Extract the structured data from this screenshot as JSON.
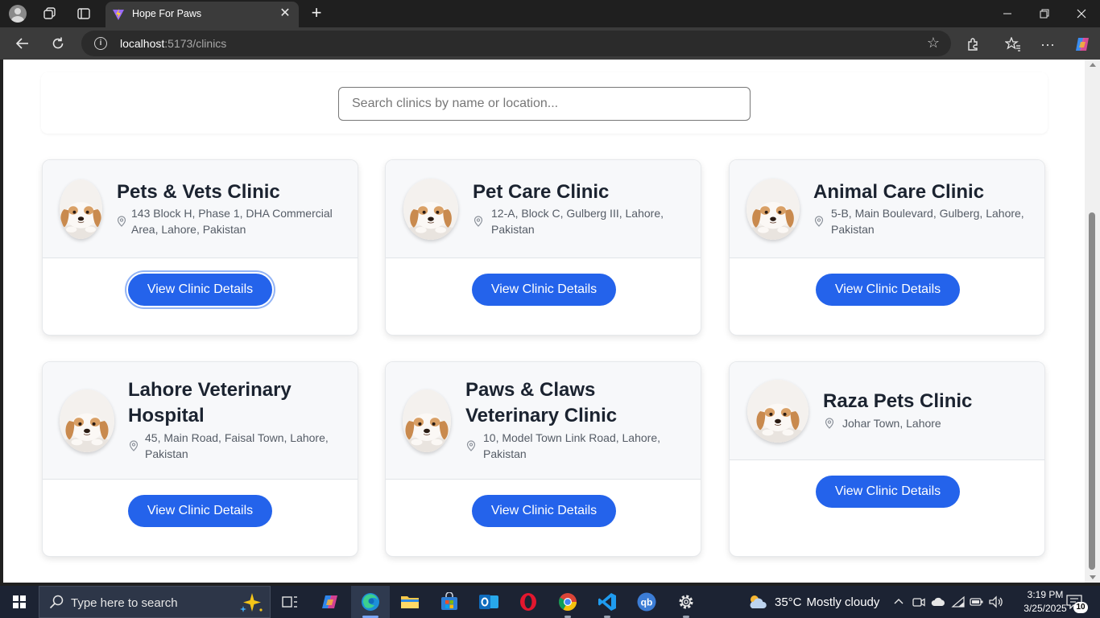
{
  "browser": {
    "tab_title": "Hope For Paws",
    "url_host": "localhost",
    "url_rest": ":5173/clinics"
  },
  "page": {
    "search_placeholder": "Search clinics by name or location...",
    "clinics": [
      {
        "name": "Pets & Vets Clinic",
        "address": "143 Block H, Phase 1, DHA Commercial Area, Lahore, Pakistan",
        "button": "View Clinic Details"
      },
      {
        "name": "Pet Care Clinic",
        "address": "12-A, Block C, Gulberg III, Lahore, Pakistan",
        "button": "View Clinic Details"
      },
      {
        "name": "Animal Care Clinic",
        "address": "5-B, Main Boulevard, Gulberg, Lahore, Pakistan",
        "button": "View Clinic Details"
      },
      {
        "name": "Lahore Veterinary Hospital",
        "address": "45, Main Road, Faisal Town, Lahore, Pakistan",
        "button": "View Clinic Details"
      },
      {
        "name": "Paws & Claws Veterinary Clinic",
        "address": "10, Model Town Link Road, Lahore, Pakistan",
        "button": "View Clinic Details"
      },
      {
        "name": "Raza Pets Clinic",
        "address": "Johar Town, Lahore",
        "button": "View Clinic Details"
      }
    ]
  },
  "taskbar": {
    "search_placeholder": "Type here to search",
    "weather_temp": "35°C",
    "weather_condition": "Mostly cloudy",
    "time": "3:19 PM",
    "date": "3/25/2025",
    "notification_count": "10"
  },
  "colors": {
    "primary_button": "#2463eb",
    "card_header": "#f7f8fa",
    "title_text": "#1b2330"
  }
}
